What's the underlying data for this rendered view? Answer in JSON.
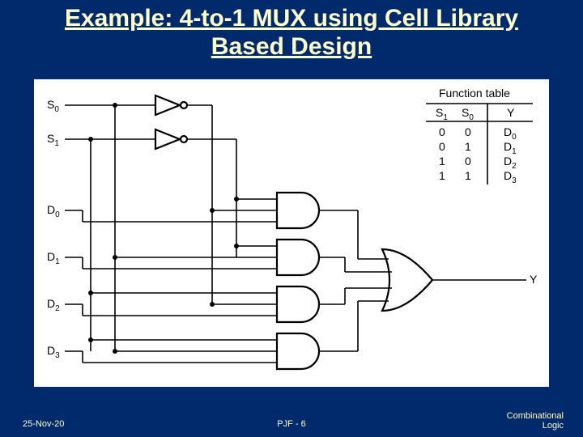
{
  "title_line1": "Example: 4-to-1 MUX using Cell Library",
  "title_line2": "Based Design",
  "footer": {
    "date": "25-Nov-20",
    "page": "PJF - 6",
    "topic1": "Combinational",
    "topic2": "Logic"
  },
  "inputs": {
    "s0": "S",
    "s0sub": "0",
    "s1": "S",
    "s1sub": "1",
    "d0": "D",
    "d0sub": "0",
    "d1": "D",
    "d1sub": "1",
    "d2": "D",
    "d2sub": "2",
    "d3": "D",
    "d3sub": "3"
  },
  "output": {
    "y": "Y"
  },
  "function_table": {
    "caption": "Function table",
    "headers": {
      "s1": "S",
      "s1sub": "1",
      "s0": "S",
      "s0sub": "0",
      "y": "Y"
    },
    "rows": [
      {
        "s1": "0",
        "s0": "0",
        "y": "D",
        "ysub": "0"
      },
      {
        "s1": "0",
        "s0": "1",
        "y": "D",
        "ysub": "1"
      },
      {
        "s1": "1",
        "s0": "0",
        "y": "D",
        "ysub": "2"
      },
      {
        "s1": "1",
        "s0": "1",
        "y": "D",
        "ysub": "3"
      }
    ]
  }
}
